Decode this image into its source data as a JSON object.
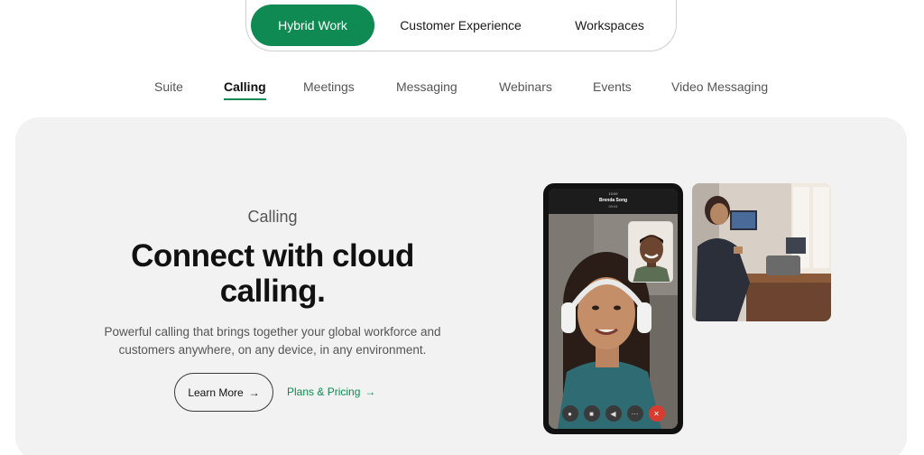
{
  "segmented": {
    "items": [
      "Hybrid Work",
      "Customer Experience",
      "Workspaces"
    ],
    "active": "Hybrid Work",
    "accent_color": "#0e8a52"
  },
  "tabs": {
    "items": [
      "Suite",
      "Calling",
      "Meetings",
      "Messaging",
      "Webinars",
      "Events",
      "Video Messaging"
    ],
    "active": "Calling"
  },
  "hero": {
    "eyebrow": "Calling",
    "headline_line1": "Connect with cloud",
    "headline_line2": "calling.",
    "description_line1": "Powerful calling that brings together your global workforce and",
    "description_line2": "customers anywhere, on any device, in any environment.",
    "primary_button": "Learn More",
    "secondary_link": "Plans & Pricing",
    "arrow_glyph": "→"
  },
  "phone": {
    "status_time": "10:09",
    "caller_name": "Brenda Song",
    "call_timer": "00:04",
    "controls": [
      "mic-icon",
      "camera-icon",
      "speaker-icon",
      "more-icon",
      "end-call-icon"
    ]
  },
  "colors": {
    "page_bg": "#ffffff",
    "card_bg": "#f2f2f2",
    "accent": "#0e8a52",
    "end_call": "#d93b2e"
  }
}
